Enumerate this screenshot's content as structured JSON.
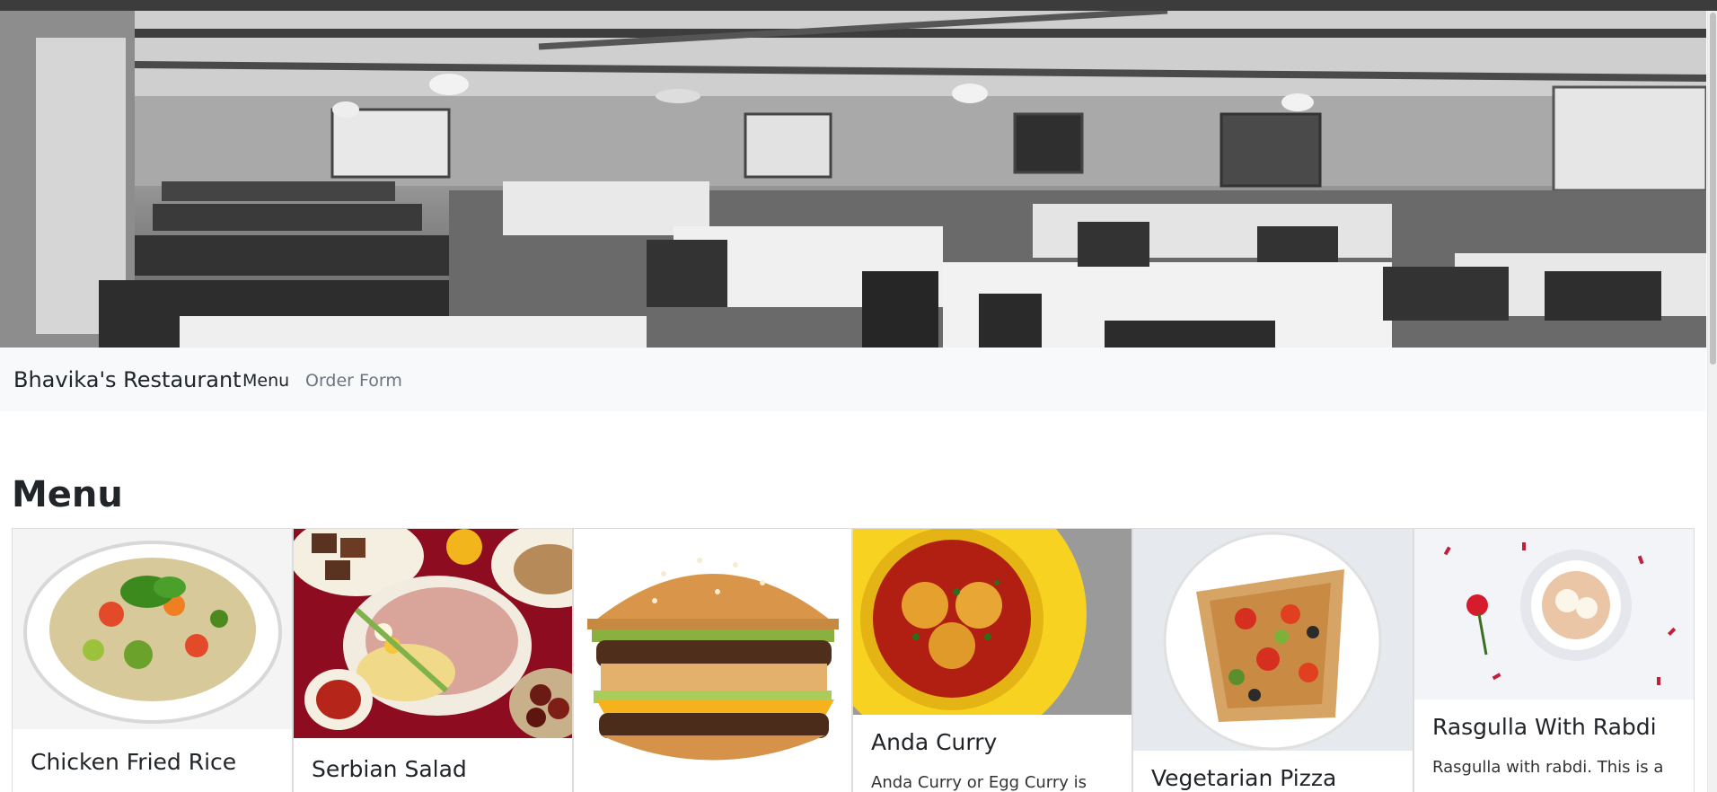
{
  "navbar": {
    "brand": "Bhavika's Restaurant",
    "links": [
      {
        "label": "Menu"
      },
      {
        "label": "Order Form"
      }
    ]
  },
  "section": {
    "heading": "Menu"
  },
  "cards": [
    {
      "title": "Chicken Fried Rice",
      "image": "chicken-fried-rice-photo",
      "text": ""
    },
    {
      "title": "Serbian Salad",
      "image": "serbian-salad-photo",
      "text": ""
    },
    {
      "title": "",
      "image": "burger-photo",
      "text": ""
    },
    {
      "title": "Anda Curry",
      "image": "anda-curry-photo",
      "text": "Anda Curry or Egg Curry is"
    },
    {
      "title": "Vegetarian Pizza",
      "image": "vegetarian-pizza-photo",
      "text": ""
    },
    {
      "title": "Rasgulla With Rabdi",
      "image": "rasgulla-photo",
      "text": "Rasgulla with rabdi. This is a"
    }
  ],
  "colors": {
    "navbar_bg": "#f8f9fa",
    "menu_link": "#212529",
    "order_link": "#6c757d",
    "curry_yellow": "#f7d221",
    "salad_red": "#8e0c1f"
  }
}
